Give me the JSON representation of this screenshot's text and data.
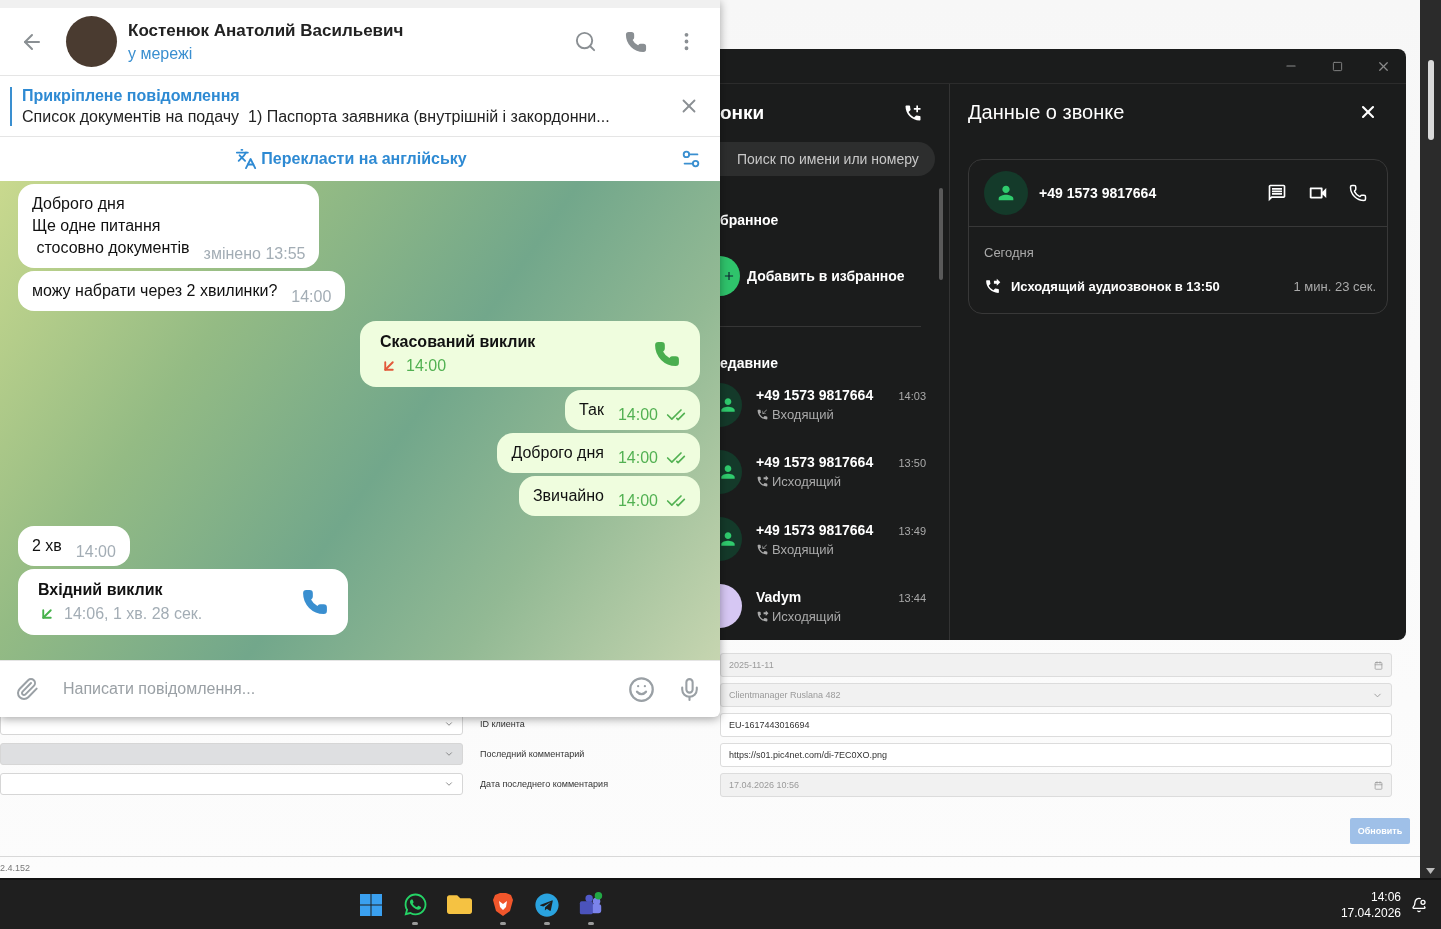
{
  "background_page": {
    "left_fields": [
      {
        "kind": "select",
        "disabled": false
      },
      {
        "kind": "select",
        "disabled": true
      },
      {
        "kind": "select",
        "disabled": false
      }
    ],
    "fields": [
      {
        "kind": "date",
        "value": "2025-11-11",
        "disabled": true
      },
      {
        "kind": "select",
        "value": "Clientmanager Ruslana 482",
        "disabled": true
      },
      {
        "kind": "text",
        "label": "ID клиента",
        "value": "EU-1617443016694",
        "disabled": false
      },
      {
        "kind": "text",
        "label": "Последний комментарий",
        "value": "https://s01.pic4net.com/di-7EC0XO.png",
        "disabled": false
      },
      {
        "kind": "date",
        "label": "Дата последнего комментария",
        "value": "17.04.2026 10:56",
        "disabled": true
      }
    ],
    "update_button": {
      "label": "Обновить",
      "disabled": true
    },
    "version": "2.4.152"
  },
  "telegram": {
    "contact": {
      "name": "Костенюк Анатолий Васильевич",
      "status": "у мережі"
    },
    "pinned": {
      "title": "Прикріплене повідомлення",
      "text": "Список документів на подачу  1) Паспорта заявника (внутрішній і закордонни..."
    },
    "translate": {
      "label": "Перекласти на англійську"
    },
    "messages": [
      {
        "outgoing": false,
        "kind": "text",
        "text": "Доброго дня\nЩе одне питання\n стосовно документів",
        "time": "змінено 13:55"
      },
      {
        "outgoing": false,
        "kind": "text",
        "text": "можу набрати через 2 хвилинки?",
        "time": "14:00"
      },
      {
        "outgoing": true,
        "kind": "call",
        "title": "Скасований виклик",
        "answered": false,
        "time": "14:00"
      },
      {
        "outgoing": true,
        "kind": "text",
        "text": "Так",
        "time": "14:00",
        "read": true
      },
      {
        "outgoing": true,
        "kind": "text",
        "text": "Доброго дня",
        "time": "14:00",
        "read": true
      },
      {
        "outgoing": true,
        "kind": "text",
        "text": "Звичайно",
        "time": "14:00",
        "read": true
      },
      {
        "outgoing": false,
        "kind": "text",
        "text": "2 хв",
        "time": "14:00"
      },
      {
        "outgoing": false,
        "kind": "call",
        "title": "Вхідний виклик",
        "answered": true,
        "time": "14:06, 1 хв. 28 сек."
      }
    ],
    "composer": {
      "placeholder": "Написати повідомлення..."
    }
  },
  "calls_app": {
    "list_title": "онки",
    "search": {
      "placeholder": "Поиск по имени или номеру"
    },
    "favorites": {
      "title": "бранное",
      "add_label": "Добавить в избранное"
    },
    "recent": {
      "title": "едавние",
      "items": [
        {
          "name": "+49 1573 9817664",
          "time": "14:03",
          "outgoing": false,
          "type_label": "Входящий",
          "has_photo": false
        },
        {
          "name": "+49 1573 9817664",
          "time": "13:50",
          "outgoing": true,
          "type_label": "Исходящий",
          "has_photo": false
        },
        {
          "name": "+49 1573 9817664",
          "time": "13:49",
          "outgoing": false,
          "type_label": "Входящий",
          "has_photo": false
        },
        {
          "name": "Vadym",
          "time": "13:44",
          "outgoing": true,
          "type_label": "Исходящий",
          "has_photo": true
        }
      ]
    },
    "details": {
      "title": "Данные о звонке",
      "number": "+49 1573 9817664",
      "day": "Сегодня",
      "entries": [
        {
          "outgoing": true,
          "text": "Исходящий аудиозвонок в 13:50",
          "duration": "1 мин. 23 сек."
        }
      ]
    }
  },
  "taskbar": {
    "apps": [
      {
        "kind": "start",
        "running": false
      },
      {
        "kind": "whatsapp",
        "running": true
      },
      {
        "kind": "files",
        "running": false
      },
      {
        "kind": "brave",
        "running": true
      },
      {
        "kind": "telegram",
        "running": true
      },
      {
        "kind": "teams",
        "running": true
      }
    ],
    "time": "14:06",
    "date": "17.04.2026"
  }
}
